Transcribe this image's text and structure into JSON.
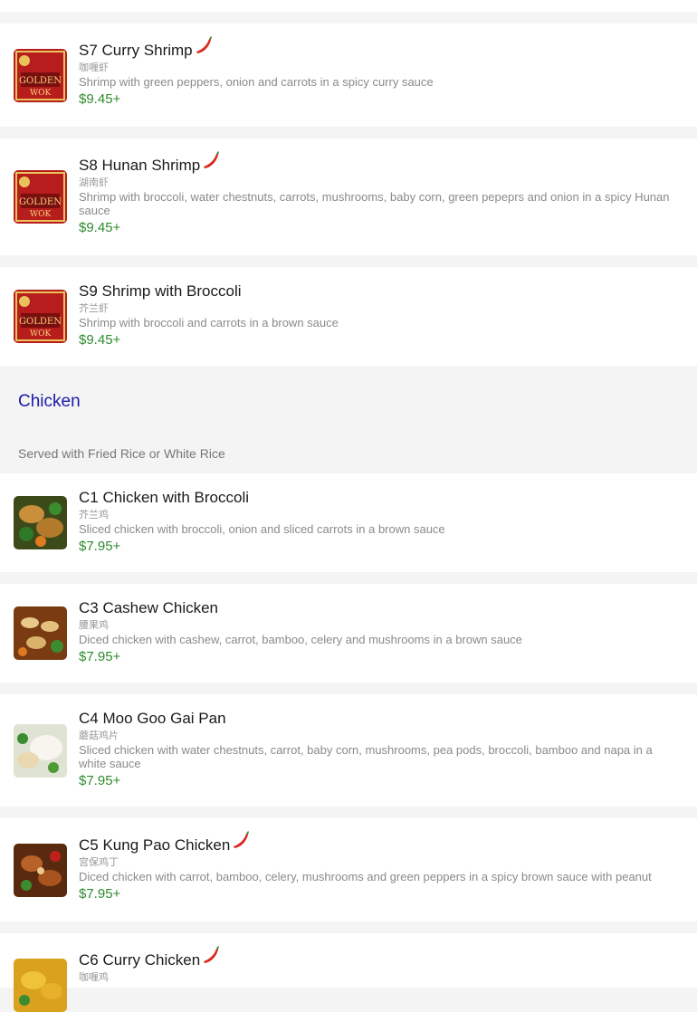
{
  "items": [
    {
      "name": "S7 Curry Shrimp",
      "spicy": true,
      "zh": "咖喱虾",
      "desc": "Shrimp with green peppers, onion and carrots in a spicy curry sauce",
      "price": "$9.45+",
      "thumb": "golden-wok-logo"
    },
    {
      "name": "S8 Hunan Shrimp",
      "spicy": true,
      "zh": "湖南虾",
      "desc": "Shrimp with broccoli, water chestnuts, carrots, mushrooms, baby corn, green pepeprs and onion in a spicy Hunan sauce",
      "price": "$9.45+",
      "thumb": "golden-wok-logo"
    },
    {
      "name": "S9 Shrimp with Broccoli",
      "spicy": false,
      "zh": "芥兰虾",
      "desc": "Shrimp with broccoli and carrots in a brown sauce",
      "price": "$9.45+",
      "thumb": "golden-wok-logo"
    },
    {
      "name": "C1 Chicken with Broccoli",
      "spicy": false,
      "zh": "芥兰鸡",
      "desc": "Sliced chicken with broccoli, onion and sliced carrots in a brown sauce",
      "price": "$7.95+",
      "thumb": "food-photo"
    },
    {
      "name": "C3 Cashew Chicken",
      "spicy": false,
      "zh": "腰果鸡",
      "desc": "Diced chicken with cashew, carrot, bamboo, celery and mushrooms in a brown sauce",
      "price": "$7.95+",
      "thumb": "food-photo"
    },
    {
      "name": "C4 Moo Goo Gai Pan",
      "spicy": false,
      "zh": "蘑菇鸡片",
      "desc": "Sliced chicken with water chestnuts, carrot, baby corn, mushrooms, pea pods, broccoli, bamboo and napa in a white sauce",
      "price": "$7.95+",
      "thumb": "food-photo"
    },
    {
      "name": "C5 Kung Pao Chicken",
      "spicy": true,
      "zh": "宫保鸡丁",
      "desc": "Diced chicken with carrot, bamboo, celery, mushrooms and green peppers in a spicy brown sauce with peanut",
      "price": "$7.95+",
      "thumb": "food-photo"
    },
    {
      "name": "C6 Curry Chicken",
      "spicy": true,
      "zh": "咖喱鸡",
      "desc": "",
      "price": "",
      "thumb": "food-photo"
    }
  ],
  "section": {
    "title": "Chicken",
    "glyph": "",
    "note": "Served with Fried Rice or White Rice"
  },
  "colors": {
    "price": "#2e8b2e",
    "section_title": "#1a1aa8",
    "pepper": "#d8281e"
  }
}
